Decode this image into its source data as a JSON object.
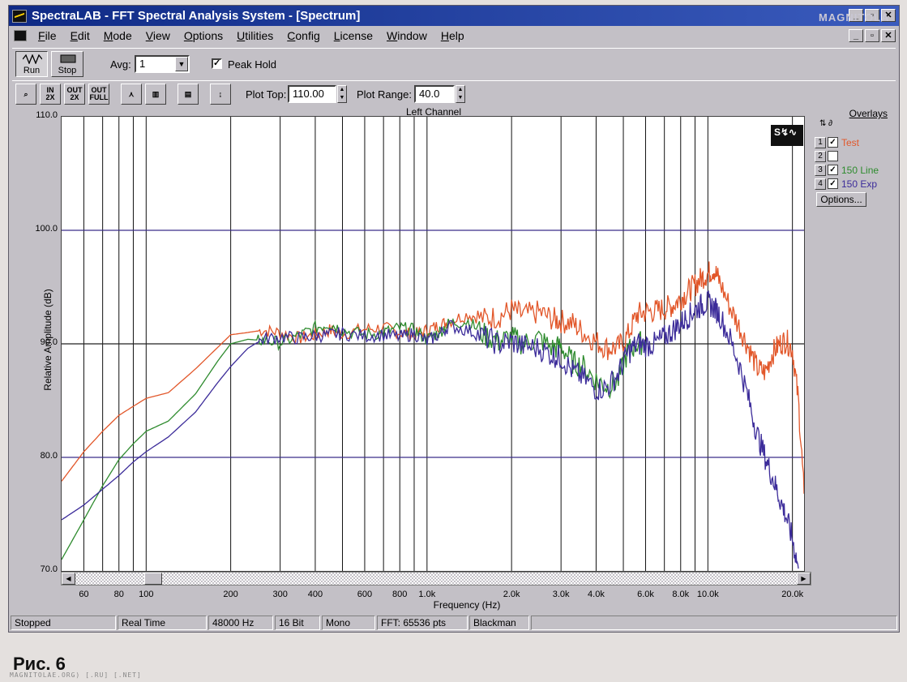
{
  "window": {
    "title": "SpectraLAB - FFT Spectral Analysis System - [Spectrum]",
    "watermark": "MAGNITOLA"
  },
  "menu": [
    "File",
    "Edit",
    "Mode",
    "View",
    "Options",
    "Utilities",
    "Config",
    "License",
    "Window",
    "Help"
  ],
  "toolbar": {
    "run_label": "Run",
    "stop_label": "Stop",
    "avg_label": "Avg:",
    "avg_value": "1",
    "peak_hold_label": "Peak Hold",
    "peak_hold_checked": "✓",
    "plot_top_label": "Plot Top:",
    "plot_top_value": "110.00",
    "plot_range_label": "Plot Range:",
    "plot_range_value": "40.0",
    "tools": [
      {
        "name": "zoom-tool",
        "glyph": "🔍"
      },
      {
        "name": "zoom-in-2x",
        "glyph": "IN\n2X"
      },
      {
        "name": "zoom-out-2x",
        "glyph": "OUT\n2X"
      },
      {
        "name": "zoom-out-full",
        "glyph": "OUT\nFULL"
      },
      {
        "name": "line-graph",
        "glyph": "∧"
      },
      {
        "name": "bar-graph",
        "glyph": "▓"
      },
      {
        "name": "table-view",
        "glyph": "≡"
      },
      {
        "name": "cursor-tool",
        "glyph": "↕"
      }
    ]
  },
  "overlays": {
    "title": "Overlays",
    "items": [
      {
        "num": "1",
        "checked": "✓",
        "label": "Test",
        "color": "#e2572a"
      },
      {
        "num": "2",
        "checked": "",
        "label": "",
        "color": "#000000"
      },
      {
        "num": "3",
        "checked": "✓",
        "label": "150 Line",
        "color": "#2e8b2e"
      },
      {
        "num": "4",
        "checked": "✓",
        "label": "150 Exp",
        "color": "#3c2c9a"
      }
    ],
    "options_label": "Options..."
  },
  "status": [
    "Stopped",
    "Real Time",
    "48000 Hz",
    "16 Bit",
    "Mono",
    "FFT: 65536 pts",
    "Blackman"
  ],
  "caption": "Рис. 6",
  "footer_watermark": "MAGNITOLAE.ORG) [.RU] [.NET]",
  "chart_data": {
    "type": "line",
    "title": "Left Channel",
    "xlabel": "Frequency (Hz)",
    "ylabel": "Relative Amplitude (dB)",
    "xscale": "log",
    "xlim": [
      50,
      22000
    ],
    "ylim": [
      70,
      110
    ],
    "y_ticks": [
      "110.0",
      "100.0",
      "90.0",
      "80.0",
      "70.0"
    ],
    "x_ticks": [
      {
        "v": 60,
        "label": "60"
      },
      {
        "v": 80,
        "label": "80"
      },
      {
        "v": 100,
        "label": "100"
      },
      {
        "v": 200,
        "label": "200"
      },
      {
        "v": 300,
        "label": "300"
      },
      {
        "v": 400,
        "label": "400"
      },
      {
        "v": 600,
        "label": "600"
      },
      {
        "v": 800,
        "label": "800"
      },
      {
        "v": 1000,
        "label": "1.0k"
      },
      {
        "v": 2000,
        "label": "2.0k"
      },
      {
        "v": 3000,
        "label": "3.0k"
      },
      {
        "v": 4000,
        "label": "4.0k"
      },
      {
        "v": 6000,
        "label": "6.0k"
      },
      {
        "v": 8000,
        "label": "8.0k"
      },
      {
        "v": 10000,
        "label": "10.0k"
      },
      {
        "v": 20000,
        "label": "20.0k"
      }
    ],
    "grid_minor_x": [
      50,
      70,
      90,
      500,
      700,
      900,
      5000,
      7000,
      9000
    ],
    "series": [
      {
        "name": "Test",
        "color": "#e2572a",
        "x": [
          50,
          60,
          70,
          80,
          90,
          100,
          120,
          150,
          180,
          200,
          230,
          260,
          300,
          350,
          400,
          450,
          500,
          600,
          700,
          800,
          900,
          1000,
          1100,
          1200,
          1400,
          1600,
          1800,
          2000,
          2200,
          2500,
          2800,
          3000,
          3300,
          3600,
          4000,
          4400,
          4800,
          5200,
          5600,
          6000,
          6500,
          7000,
          7500,
          8000,
          8500,
          9000,
          9500,
          10000,
          10500,
          11000,
          12000,
          13000,
          14000,
          15000,
          16000,
          17000,
          18000,
          19000,
          20000,
          21000,
          22000
        ],
        "y": [
          77.9,
          80.5,
          82.3,
          83.7,
          84.5,
          85.2,
          85.7,
          87.8,
          89.7,
          90.8,
          91.0,
          91.2,
          91.0,
          90.5,
          90.8,
          91.2,
          90.9,
          91.3,
          91.4,
          91.0,
          90.8,
          91.2,
          91.6,
          92.0,
          92.6,
          92.2,
          92.4,
          93.0,
          92.5,
          92.8,
          92.2,
          92.0,
          91.8,
          91.0,
          90.2,
          89.6,
          89.7,
          90.8,
          92.6,
          92.8,
          92.9,
          93.1,
          93.4,
          94.0,
          94.6,
          95.2,
          95.8,
          96.2,
          96.6,
          95.5,
          93.2,
          91.4,
          89.6,
          87.8,
          87.5,
          89.2,
          90.0,
          90.3,
          89.5,
          85.0,
          76.8
        ]
      },
      {
        "name": "150 Line",
        "color": "#2e8b2e",
        "x": [
          50,
          60,
          70,
          80,
          90,
          100,
          120,
          150,
          180,
          200,
          230,
          260,
          300,
          350,
          400,
          450,
          500,
          600,
          700,
          800,
          900,
          1000,
          1100,
          1200,
          1400,
          1600,
          1800,
          2000,
          2200,
          2500,
          2800,
          3000,
          3300,
          3600,
          4000,
          4400,
          4800,
          5200,
          5600,
          6000
        ],
        "y": [
          71.0,
          74.5,
          77.5,
          79.8,
          81.2,
          82.3,
          83.2,
          85.6,
          88.5,
          90.0,
          90.4,
          90.3,
          90.1,
          90.7,
          91.4,
          91.8,
          91.2,
          90.8,
          91.0,
          91.4,
          91.2,
          90.4,
          91.0,
          91.8,
          92.0,
          90.8,
          90.2,
          90.6,
          90.0,
          90.5,
          89.6,
          89.8,
          88.4,
          88.0,
          86.8,
          86.2,
          86.8,
          89.4,
          90.0,
          90.2
        ]
      },
      {
        "name": "150 Exp",
        "color": "#3c2c9a",
        "x": [
          50,
          60,
          70,
          80,
          90,
          100,
          120,
          150,
          180,
          200,
          230,
          260,
          300,
          350,
          400,
          450,
          500,
          600,
          700,
          800,
          900,
          1000,
          1100,
          1200,
          1400,
          1600,
          1800,
          2000,
          2200,
          2500,
          2800,
          3000,
          3300,
          3600,
          4000,
          4400,
          4800,
          5200,
          5600,
          6000,
          6500,
          7000,
          7500,
          8000,
          8500,
          9000,
          9500,
          10000,
          10500,
          11000,
          12000,
          13000,
          14000,
          15000,
          16000,
          17000,
          18000,
          19000,
          20000,
          21000
        ],
        "y": [
          74.5,
          75.8,
          77.2,
          78.4,
          79.6,
          80.5,
          81.8,
          84.0,
          86.6,
          88.0,
          89.6,
          90.4,
          90.6,
          90.5,
          90.7,
          90.8,
          90.9,
          90.7,
          90.8,
          90.6,
          90.9,
          90.2,
          90.8,
          91.6,
          91.2,
          90.6,
          90.0,
          90.2,
          89.8,
          89.6,
          89.0,
          88.8,
          87.6,
          87.0,
          86.0,
          86.2,
          87.4,
          89.2,
          90.0,
          89.9,
          90.0,
          90.6,
          91.2,
          91.8,
          92.4,
          93.0,
          93.4,
          93.6,
          93.2,
          92.6,
          90.4,
          88.0,
          85.0,
          82.0,
          80.0,
          78.2,
          76.4,
          74.8,
          72.8,
          70.2
        ]
      }
    ]
  }
}
